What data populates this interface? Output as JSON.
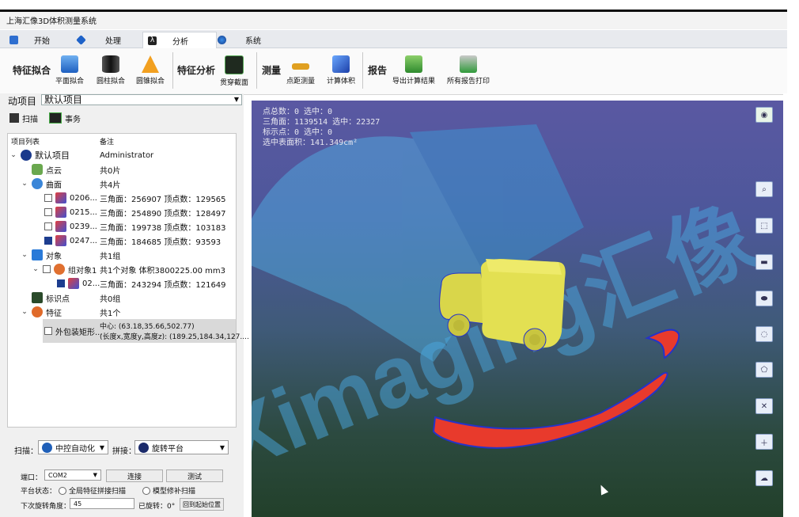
{
  "window": {
    "title": "上海汇像3D体积测量系统"
  },
  "tabs": [
    {
      "label": "开始",
      "icon": "home-icon"
    },
    {
      "label": "处理",
      "icon": "diamond-icon"
    },
    {
      "label": "分析",
      "icon": "lambda-icon"
    },
    {
      "label": "系统",
      "icon": "globe-icon"
    }
  ],
  "ribbon": {
    "groups": {
      "fit": "特征拟合",
      "feature": "特征分析",
      "measure": "测量",
      "report": "报告"
    },
    "buttons": {
      "plane_fit": "平面拟合",
      "cylinder_fit": "圆柱拟合",
      "cone_fit": "圆锥拟合",
      "cross_section": "贯穿截面",
      "distance": "点距测量",
      "volume": "计算体积",
      "export": "导出计算结果",
      "print": "所有报告打印"
    }
  },
  "left": {
    "project_label": "动项目",
    "project_value": "默认项目",
    "subtabs": {
      "scan": "扫描",
      "task": "事务"
    },
    "tree_headers": {
      "col1": "项目列表",
      "col2": "备注"
    },
    "tree": {
      "root": {
        "name": "默认项目",
        "note": "Administrator"
      },
      "pointcloud": {
        "name": "点云",
        "note": "共0片"
      },
      "surface": {
        "name": "曲面",
        "note": "共4片"
      },
      "s1": {
        "name": "0206...",
        "note": "三角面：256907 顶点数：129565"
      },
      "s2": {
        "name": "0215...",
        "note": "三角面：254890 顶点数：128497"
      },
      "s3": {
        "name": "0239...",
        "note": "三角面：199738 顶点数：103183"
      },
      "s4": {
        "name": "0247...",
        "note": "三角面：184685 顶点数：93593"
      },
      "objects": {
        "name": "对象",
        "note": "共1组"
      },
      "group1": {
        "name": "组对象1",
        "note": "共1个对象  体积3800225.00 mm3"
      },
      "g1item": {
        "name": "02...",
        "note": "三角面：243294 顶点数：121649"
      },
      "markers": {
        "name": "标识点",
        "note": "共0组"
      },
      "features": {
        "name": "特征",
        "note": "共1个"
      },
      "bbox": {
        "name": "外包装矩形...",
        "note1": "中心:    (63.18,35.66,502.77)",
        "note2": "(长度x,宽度y,高度z):  (189.25,184.34,127...."
      }
    },
    "bottom": {
      "scan_label": "扫描：",
      "scan_value": "中控自动化",
      "stitch_label": "拼接：",
      "stitch_value": "旋转平台",
      "port_label": "端口：",
      "port_value": "COM2",
      "connect": "连接",
      "test": "测试",
      "platform_label": "平台状态：",
      "radio1": "全局特征拼接扫描",
      "radio2": "模型修补扫描",
      "angle_label": "下次旋转角度：",
      "angle_value": "45",
      "rotated_label": "已旋转：0°",
      "reset": "回到起始位置"
    }
  },
  "viewport": {
    "stats": [
      "点总数：0 选中：0",
      "三角面：1139514 选中：22327",
      "标示点：0 选中：0",
      "选中表面积：141.349cm²"
    ],
    "watermark": "Ximaging汇像",
    "colors": {
      "model": "#d4d24a",
      "selection": "#e8382e",
      "edge": "#2533c8"
    }
  }
}
